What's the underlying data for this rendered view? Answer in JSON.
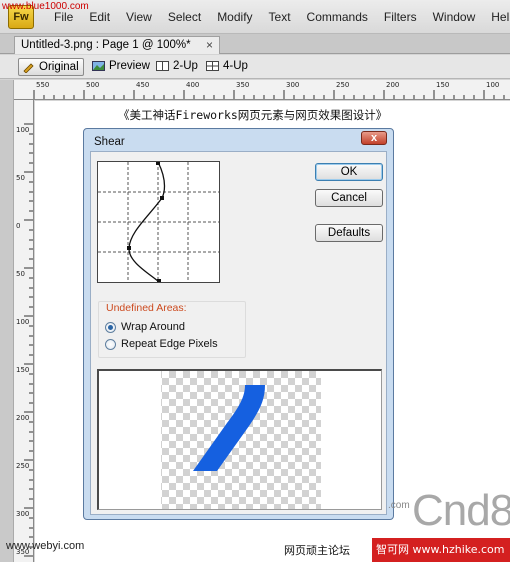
{
  "app": {
    "logo_text": "Fw",
    "watermark_url": "www.blue1000.com",
    "menu": [
      "File",
      "Edit",
      "View",
      "Select",
      "Modify",
      "Text",
      "Commands",
      "Filters",
      "Window",
      "Help"
    ]
  },
  "document": {
    "tab_title": "Untitled-3.png : Page 1 @ 100%*",
    "tab_close": "×",
    "views": [
      "Original",
      "Preview",
      "2-Up",
      "4-Up"
    ],
    "active_view": "Original"
  },
  "rulers": {
    "horizontal_labels": [
      "550",
      "500",
      "450",
      "400",
      "350",
      "300",
      "250",
      "200",
      "150",
      "100"
    ],
    "vertical_labels": [
      "100",
      "50",
      "0",
      "50",
      "100",
      "150",
      "200",
      "250",
      "300",
      "350"
    ]
  },
  "canvas": {
    "heading": "《美工神话Fireworks网页元素与网页效果图设计》"
  },
  "dialog": {
    "title": "Shear",
    "close": "x",
    "ok": "OK",
    "cancel": "Cancel",
    "defaults": "Defaults",
    "group_label": "Undefined Areas:",
    "options": [
      "Wrap Around",
      "Repeat Edge Pixels"
    ],
    "selected_option": "Wrap Around"
  },
  "footer": {
    "site_left": "www.webyi.com",
    "site_mid": "网页顽主论坛",
    "brand_small": ".com",
    "brand": "Cnd8",
    "brand_bar": "智可网 www.hzhike.com"
  },
  "colors": {
    "accent_blue": "#1560e0",
    "group_label": "#cc4a1f",
    "dialog_frame": "#c9dcf0",
    "brand_red": "#d42020"
  }
}
